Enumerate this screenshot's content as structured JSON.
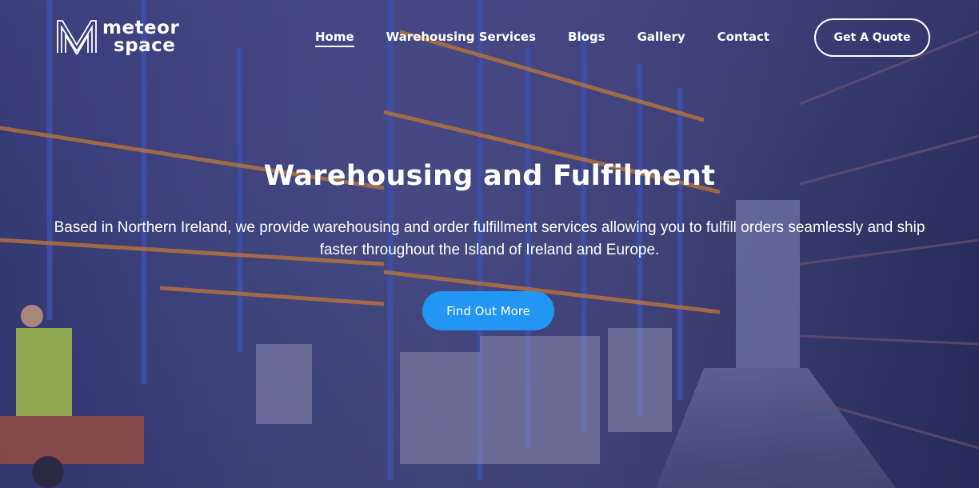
{
  "brand": {
    "line1": "meteor",
    "line2": "space"
  },
  "nav": {
    "items": [
      {
        "label": "Home",
        "active": true
      },
      {
        "label": "Warehousing Services",
        "active": false
      },
      {
        "label": "Blogs",
        "active": false
      },
      {
        "label": "Gallery",
        "active": false
      },
      {
        "label": "Contact",
        "active": false
      }
    ],
    "quote_button": "Get A Quote"
  },
  "hero": {
    "title": "Warehousing and Fulfilment",
    "subtitle": "Based in Northern Ireland, we provide warehousing and order fulfillment services allowing you to fulfill orders seamlessly and ship faster throughout the Island of Ireland and Europe.",
    "cta": "Find Out More"
  },
  "colors": {
    "accent": "#2196f3",
    "overlay": "#3c4180"
  }
}
